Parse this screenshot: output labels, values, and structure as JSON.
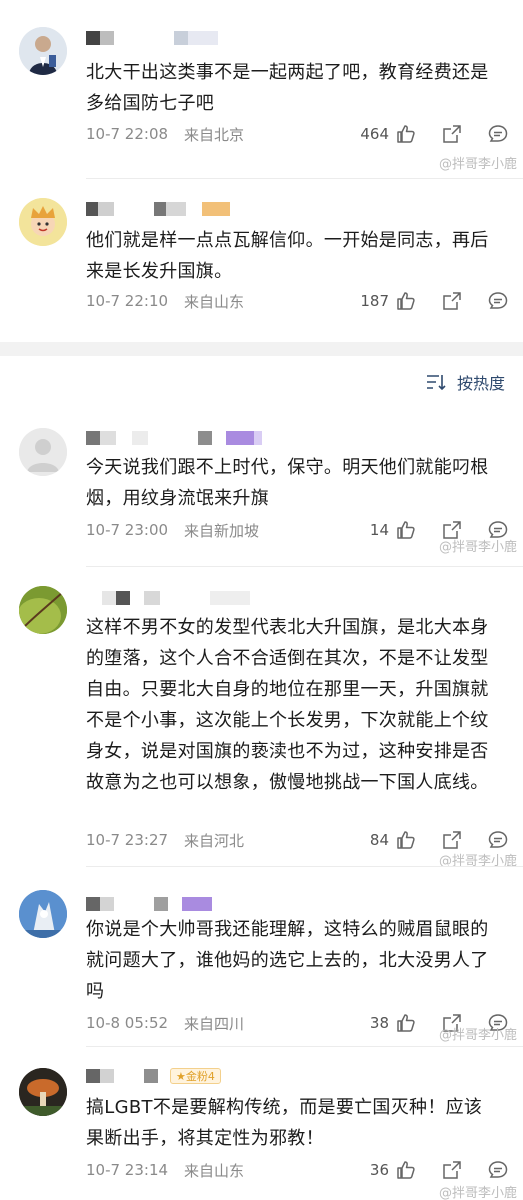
{
  "sort": {
    "label": "按热度",
    "icon": "sort-icon"
  },
  "watermark": "@拌哥李小鹿",
  "comments": [
    {
      "text": "北大干出这类事不是一起两起了吧，教育经费还是多给国防七子吧",
      "time": "10-7 22:08",
      "location": "来自北京",
      "likes": "464"
    },
    {
      "text": "他们就是样一点点瓦解信仰。一开始是同志，再后来是长发升国旗。",
      "time": "10-7 22:10",
      "location": "来自山东",
      "likes": "187"
    },
    {
      "text": "今天说我们跟不上时代，保守。明天他们就能叼根烟，用纹身流氓来升旗",
      "time": "10-7 23:00",
      "location": "来自新加坡",
      "likes": "14"
    },
    {
      "text": "这样不男不女的发型代表北大升国旗，是北大本身的堕落，这个人合不合适倒在其次，不是不让发型自由。只要北大自身的地位在那里一天，升国旗就不是个小事，这次能上个长发男，下次就能上个纹身女，说是对国旗的亵渎也不为过，这种安排是否故意为之也可以想象，傲慢地挑战一下国人底线。",
      "time": "10-7 23:27",
      "location": "来自河北",
      "likes": "84"
    },
    {
      "text": "你说是个大帅哥我还能理解，这特么的贼眉鼠眼的就问题大了，谁他妈的选它上去的，北大没男人了吗",
      "time": "10-8 05:52",
      "location": "来自四川",
      "likes": "38"
    },
    {
      "text": "搞LGBT不是要解构传统，而是要亡国灭种！应该果断出手，将其定性为邪教！",
      "time": "10-7 23:14",
      "location": "来自山东",
      "likes": "36",
      "badge": "金粉4"
    }
  ],
  "colors": {
    "accent": "#2f4a6e",
    "meta": "#8a8a8a",
    "badge": "#e0a12a"
  }
}
